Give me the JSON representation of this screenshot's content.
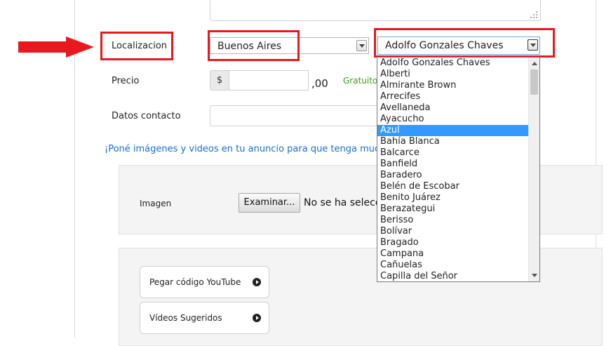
{
  "form": {
    "location_label": "Localizacion",
    "province_value": "Buenos Aires",
    "city_value": "Adolfo Gonzales Chaves",
    "price_label": "Precio",
    "currency_symbol": "$",
    "price_value": "",
    "price_cents": ",00",
    "free_link": "Gratuito",
    "contact_label": "Datos contacto",
    "contact_value": "",
    "media_promo": "¡Poné imágenes y videos en tu anuncio para que tenga much"
  },
  "image_panel": {
    "label": "Imagen",
    "browse_button": "Examinar...",
    "file_status": "No se ha selecci"
  },
  "video_panel": {
    "youtube_button": "Pegar código YouTube",
    "suggested_button": "Vídeos Sugeridos",
    "button_icon": "circle-arrow-right-icon"
  },
  "city_dropdown": {
    "selected": "Azul",
    "options": [
      "Adolfo Gonzales Chaves",
      "Alberti",
      "Almirante Brown",
      "Arrecifes",
      "Avellaneda",
      "Ayacucho",
      "Azul",
      "Bahía Blanca",
      "Balcarce",
      "Banfield",
      "Baradero",
      "Belén de Escobar",
      "Benito Juárez",
      "Berazategui",
      "Berisso",
      "Bolívar",
      "Bragado",
      "Campana",
      "Cañuelas",
      "Capilla del Señor"
    ]
  },
  "annotation": {
    "color": "#e8191e",
    "arrow_icon": "red-arrow-icon"
  }
}
